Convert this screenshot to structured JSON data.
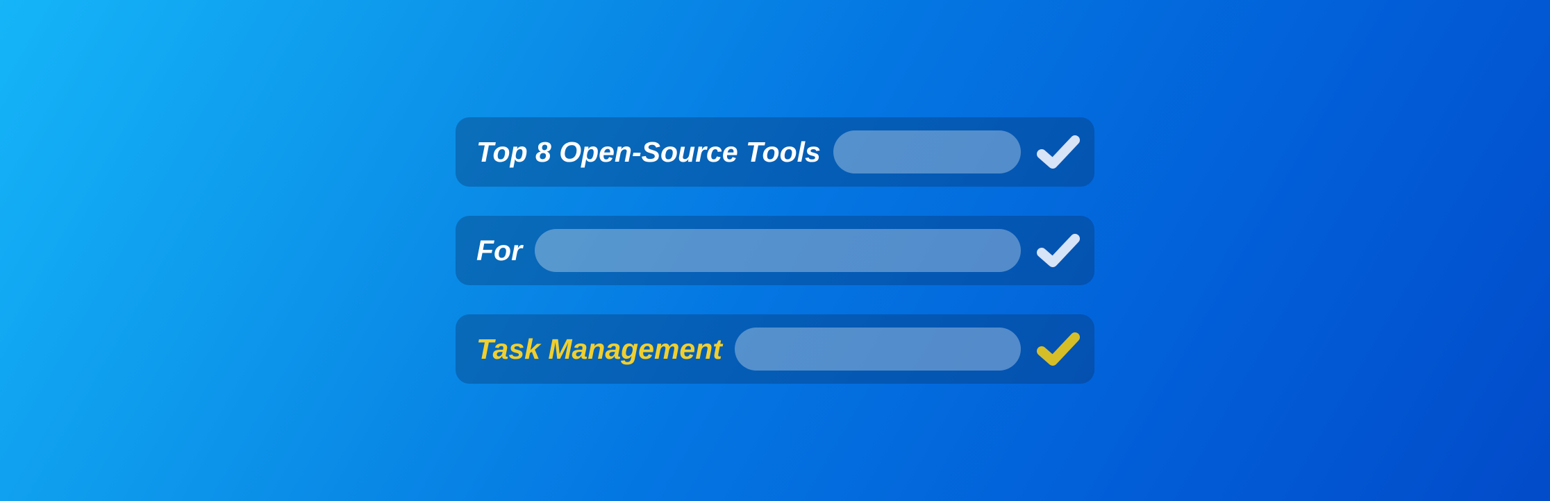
{
  "rows": [
    {
      "label": "Top 8 Open-Source Tools",
      "accent": false,
      "check": "light"
    },
    {
      "label": "For",
      "accent": false,
      "check": "light"
    },
    {
      "label": "Task Management",
      "accent": true,
      "check": "gold"
    }
  ]
}
